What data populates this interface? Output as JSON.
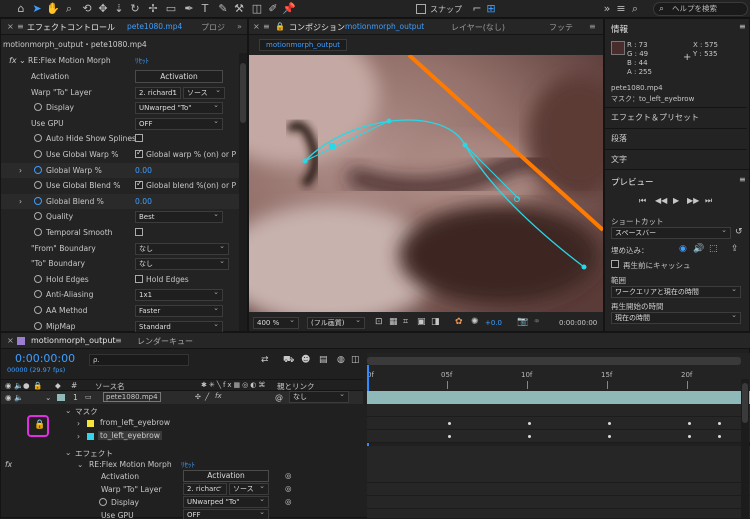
{
  "toolbar": {
    "snap_label": "スナップ",
    "search_placeholder": "ヘルプを検索"
  },
  "effect_controls": {
    "tab_title": "エフェクトコントロール",
    "tab_file": "pete1080.mp4",
    "tab_next": "プロジ",
    "breadcrumb": "motionmorph_output・pete1080.mp4",
    "fx": "fx",
    "effect_name": "RE:Flex Motion Morph",
    "reset": "ﾘｾｯﾄ",
    "rows": [
      {
        "label": "Activation",
        "type": "button",
        "value": "Activation"
      },
      {
        "label": "Warp \"To\" Layer",
        "type": "dropdown2",
        "value": "2. richard1",
        "value2": "ソース"
      },
      {
        "label": "Display",
        "type": "dropdown",
        "value": "UNwarped \"To\"",
        "stopwatch": true
      },
      {
        "label": "Use GPU",
        "type": "dropdown",
        "value": "OFF"
      },
      {
        "label": "Auto Hide Show Splines",
        "type": "check",
        "value": "",
        "checked": false,
        "stopwatch": true
      },
      {
        "label": "Use Global Warp %",
        "type": "check",
        "value": "Global warp % (on) or P",
        "checked": true,
        "stopwatch": true
      },
      {
        "label": "Global Warp %",
        "type": "number",
        "value": "0.00",
        "stopwatch": true,
        "twirl": true
      },
      {
        "label": "Use Global Blend %",
        "type": "check",
        "value": "Global blend %(on) or P",
        "checked": true,
        "stopwatch": true
      },
      {
        "label": "Global Blend %",
        "type": "number",
        "value": "0.00",
        "stopwatch": true,
        "twirl": true
      },
      {
        "label": "Quality",
        "type": "dropdown",
        "value": "Best",
        "stopwatch": true
      },
      {
        "label": "Temporal Smooth",
        "type": "check",
        "value": "",
        "checked": false,
        "stopwatch": true
      },
      {
        "label": "\"From\" Boundary",
        "type": "dropdown",
        "value": "なし"
      },
      {
        "label": "\"To\" Boundary",
        "type": "dropdown",
        "value": "なし"
      },
      {
        "label": "Hold Edges",
        "type": "check",
        "value": "Hold Edges",
        "checked": false,
        "stopwatch": true
      },
      {
        "label": "Anti-Aliasing",
        "type": "dropdown",
        "value": "1x1",
        "stopwatch": true
      },
      {
        "label": "AA Method",
        "type": "dropdown",
        "value": "Faster",
        "stopwatch": true
      },
      {
        "label": "MipMap",
        "type": "dropdown",
        "value": "Standard",
        "stopwatch": true
      }
    ]
  },
  "composition": {
    "tab_title": "コンポジション",
    "tab_name": "motionmorph_output",
    "tab_layer": "レイヤー(なし)",
    "tab_footage": "フッテ",
    "subtab": "motionmorph_output",
    "zoom": "400 %",
    "resolution": "(フル画質)",
    "exposure": "+0.0",
    "timecode": "0:00:00:00"
  },
  "info": {
    "title": "情報",
    "r": "R : 73",
    "g": "G : 49",
    "b": "B : 44",
    "a": "A : 255",
    "x": "X : 575",
    "y": "Y : 535",
    "file": "pete1080.mp4",
    "mask": "マスク：to_left_eyebrow",
    "swatch": "#492c2c"
  },
  "right_panels": [
    {
      "label": "エフェクト＆プリセット"
    },
    {
      "label": "段落"
    },
    {
      "label": "文字"
    }
  ],
  "preview": {
    "title": "プレビュー",
    "shortcut_label": "ショートカット",
    "shortcut_value": "スペースバー",
    "embed_label": "埋め込み：",
    "cache_label": "再生前にキャッシュ",
    "range_label": "範囲",
    "range_value": "ワークエリアと現在の時間",
    "start_label": "再生開始の時間",
    "start_value": "現在の時間"
  },
  "timeline": {
    "tab_name": "motionmorph_output",
    "render_queue": "レンダーキュー",
    "timecode": "0:00:00:00",
    "fps": "00000 (29.97 fps)",
    "search_placeholder": "ρ.",
    "col_num": "#",
    "col_source": "ソース名",
    "col_parent": "親とリンク",
    "ruler": [
      "0f",
      "05f",
      "10f",
      "15f",
      "20f"
    ],
    "layer_num": "1",
    "layer_name": "pete1080.mp4",
    "layer_parent": "なし",
    "mask_group": "マスク",
    "masks": [
      {
        "name": "from_left_eyebrow",
        "color": "#f5e33a"
      },
      {
        "name": "to_left_eyebrow",
        "color": "#33d6e8"
      }
    ],
    "effects_group": "エフェクト",
    "effect_name": "RE:Flex Motion Morph",
    "reset": "ﾘｾｯﾄ",
    "activation_label": "Activation",
    "activation_button": "Activation",
    "warp_label": "Warp \"To\" Layer",
    "warp_value": "2. richarc",
    "warp_value2": "ソース",
    "display_label": "Display",
    "display_value": "UNwarped \"To\"",
    "gpu_label": "Use GPU",
    "gpu_value": "OFF",
    "fx_label": "fx"
  },
  "colors": {
    "accent": "#3e9eff",
    "lock_highlight": "#e02ee0",
    "spline": "#27d8e8",
    "orange_line": "#ff7a00"
  }
}
